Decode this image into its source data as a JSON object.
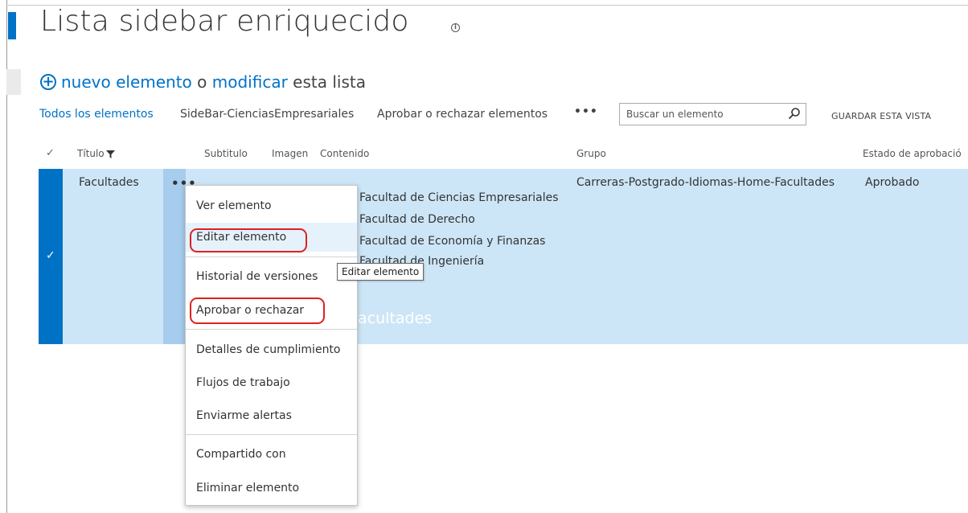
{
  "page": {
    "title": "Lista sidebar enriquecido",
    "info_icon": "info-circle-icon"
  },
  "toolbar": {
    "new_item_icon": "plus-circle-icon",
    "new_item_label": "nuevo elemento",
    "or_label": "o",
    "edit_label": "modificar",
    "this_list_label": "esta lista"
  },
  "views": {
    "all_items": "Todos los elementos",
    "sidebar": "SideBar-CienciasEmpresariales",
    "approve": "Aprobar o rechazar elementos",
    "more": "•••",
    "search_placeholder": "Buscar un elemento",
    "save_view": "GUARDAR ESTA VISTA"
  },
  "columns": {
    "check": "✓",
    "title": "Título",
    "subtitle": "Subtitulo",
    "image": "Imagen",
    "content": "Contenido",
    "group": "Grupo",
    "approval": "Estado de aprobació"
  },
  "row": {
    "check": "✓",
    "title": "Facultades",
    "ellipsis": "•••",
    "content": [
      "Facultad de Ciencias Empresariales",
      "Facultad de Derecho",
      "Facultad de Economía y Finanzas",
      "Facultad de Ingeniería"
    ],
    "content_tail": "acultades",
    "group": "Carreras-Postgrado-Idiomas-Home-Facultades",
    "approval": "Aprobado"
  },
  "context_menu": {
    "items": [
      "Ver elemento",
      "Editar elemento",
      "Historial de versiones",
      "Aprobar o rechazar",
      "Detalles de cumplimiento",
      "Flujos de trabajo",
      "Enviarme alertas",
      "Compartido con",
      "Eliminar elemento"
    ],
    "highlight_color": "#e02020"
  },
  "tooltip": "Editar elemento",
  "colors": {
    "accent": "#0072c6",
    "selected_row": "#cde6f7"
  }
}
